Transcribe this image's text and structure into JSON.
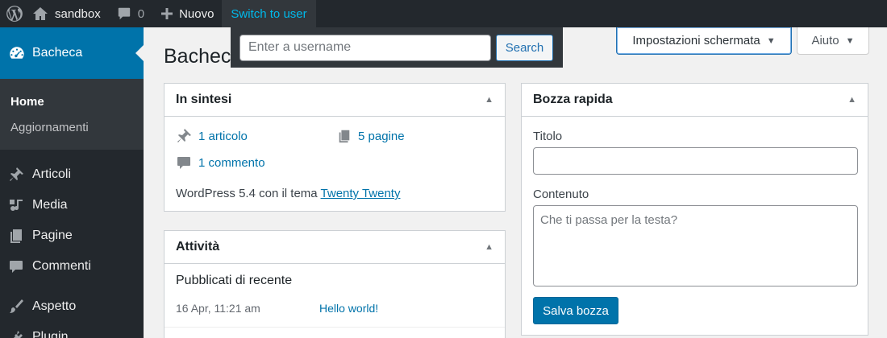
{
  "adminbar": {
    "site_name": "sandbox",
    "comments_count": "0",
    "new_label": "Nuovo",
    "switch_user_label": "Switch to user"
  },
  "switch_user": {
    "placeholder": "Enter a username",
    "search_label": "Search"
  },
  "sidebar": {
    "current": "Bacheca",
    "submenu": [
      "Home",
      "Aggiornamenti"
    ],
    "items": [
      {
        "label": "Articoli",
        "icon": "pin-icon"
      },
      {
        "label": "Media",
        "icon": "media-icon"
      },
      {
        "label": "Pagine",
        "icon": "pages-icon"
      },
      {
        "label": "Commenti",
        "icon": "comment-icon"
      },
      {
        "label": "Aspetto",
        "icon": "brush-icon"
      },
      {
        "label": "Plugin",
        "icon": "plugin-icon"
      }
    ]
  },
  "header": {
    "screen_options": "Impostazioni schermata",
    "help": "Aiuto",
    "page_title": "Bacheca"
  },
  "glance": {
    "title": "In sintesi",
    "posts": "1 articolo",
    "pages": "5 pagine",
    "comments": "1 commento",
    "footer_prefix": "WordPress 5.4 con il tema ",
    "theme_name": "Twenty Twenty"
  },
  "activity": {
    "title": "Attività",
    "subtitle": "Pubblicati di recente",
    "items": [
      {
        "date": "16 Apr, 11:21 am",
        "title": "Hello world!"
      }
    ]
  },
  "quick_draft": {
    "title": "Bozza rapida",
    "title_label": "Titolo",
    "content_label": "Contenuto",
    "content_placeholder": "Che ti passa per la testa?",
    "save_label": "Salva bozza"
  },
  "colors": {
    "adminbar_bg": "#23282d",
    "accent": "#0073aa",
    "link": "#0073aa",
    "switch_user_text": "#00b9eb"
  }
}
